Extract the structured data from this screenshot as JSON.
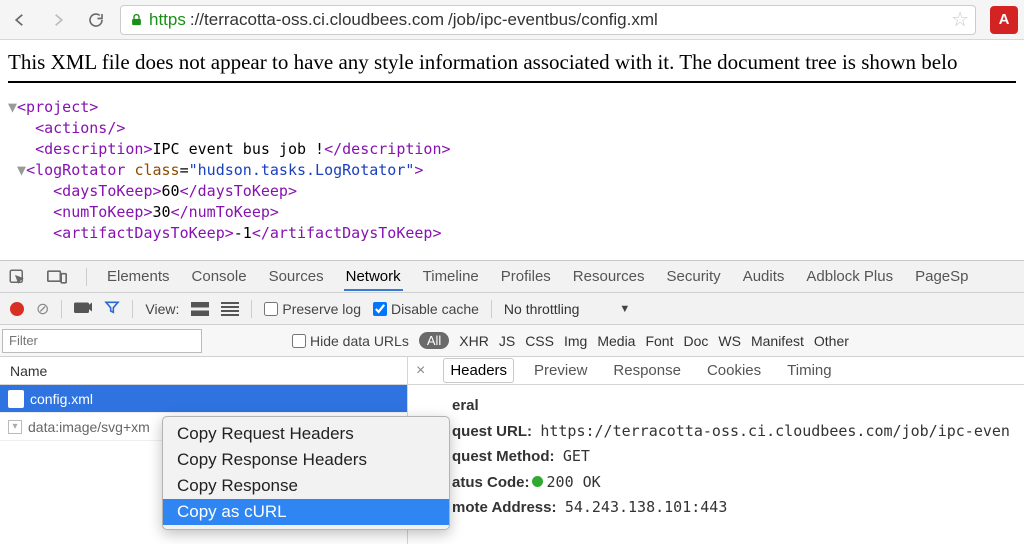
{
  "browser": {
    "url_scheme": "https",
    "url_host": "://terracotta-oss.ci.cloudbees.com",
    "url_path": "/job/ipc-eventbus/config.xml"
  },
  "xml": {
    "banner": "This XML file does not appear to have any style information associated with it. The document tree is shown belo",
    "root_open": "<project>",
    "actions": "<actions/>",
    "desc_open": "<description>",
    "desc_text": "IPC event bus job !",
    "desc_close": "</description>",
    "logrot_open1": "<logRotator ",
    "logrot_attr": "class",
    "logrot_eq": "=",
    "logrot_val": "\"hudson.tasks.LogRotator\"",
    "logrot_open2": ">",
    "d2k_open": "<daysToKeep>",
    "d2k_val": "60",
    "d2k_close": "</daysToKeep>",
    "n2k_open": "<numToKeep>",
    "n2k_val": "30",
    "n2k_close": "</numToKeep>",
    "adk_open": "<artifactDaysToKeep>",
    "adk_val": "-1",
    "adk_close": "</artifactDaysToKeep>"
  },
  "devtools": {
    "tabs": {
      "elements": "Elements",
      "console": "Console",
      "sources": "Sources",
      "network": "Network",
      "timeline": "Timeline",
      "profiles": "Profiles",
      "resources": "Resources",
      "security": "Security",
      "audits": "Audits",
      "adblock": "Adblock Plus",
      "pagesp": "PageSp"
    },
    "toolbar": {
      "view_label": "View:",
      "preserve": "Preserve log",
      "disable_cache": "Disable cache",
      "throttle": "No throttling"
    },
    "filterbar": {
      "placeholder": "Filter",
      "hide_urls": "Hide data URLs",
      "types": {
        "all": "All",
        "xhr": "XHR",
        "js": "JS",
        "css": "CSS",
        "img": "Img",
        "media": "Media",
        "font": "Font",
        "doc": "Doc",
        "ws": "WS",
        "manifest": "Manifest",
        "other": "Other"
      }
    },
    "reqlist": {
      "col_name": "Name",
      "rows": [
        "config.xml",
        "data:image/svg+xm"
      ]
    },
    "detail": {
      "tabs": {
        "headers": "Headers",
        "preview": "Preview",
        "response": "Response",
        "cookies": "Cookies",
        "timing": "Timing"
      },
      "section": "eral",
      "req_url_label": "quest URL:",
      "req_url_value": "https://terracotta-oss.ci.cloudbees.com/job/ipc-even",
      "req_method_label": "quest Method:",
      "req_method_value": "GET",
      "status_label": "atus Code:",
      "status_value": "200 OK",
      "remote_label": "mote Address:",
      "remote_value": "54.243.138.101:443"
    }
  },
  "context_menu": {
    "items": [
      "Copy Request Headers",
      "Copy Response Headers",
      "Copy Response",
      "Copy as cURL"
    ],
    "hover_index": 3
  }
}
